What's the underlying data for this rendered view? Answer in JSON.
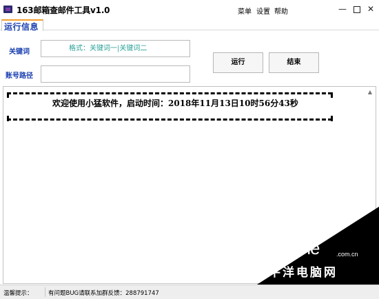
{
  "window": {
    "title": "163邮箱查邮件工具v1.0",
    "menu": [
      "菜单",
      "设置",
      "帮助"
    ],
    "controls": {
      "minimize": "—",
      "close": "✕"
    }
  },
  "tabs": [
    {
      "label": "运行信息",
      "active": true
    }
  ],
  "form": {
    "keyword_label": "关键词",
    "keyword_placeholder": "格式：关键词一|关键词二",
    "path_label": "账号路径",
    "path_value": ""
  },
  "buttons": {
    "run": "运行",
    "stop": "结束"
  },
  "log": {
    "line": "欢迎使用小猛软件，启动时间：2018年11月13日10时56分43秒"
  },
  "watermark": {
    "brand": "PConline",
    "domain": ".com.cn",
    "subtitle": "太平洋电脑网"
  },
  "status": {
    "label": "温馨提示：",
    "message": "有问题BUG请联系加群反馈：288791747"
  },
  "colors": {
    "label_blue": "#1a3fb0",
    "placeholder_teal": "#2aa198",
    "tab_accent": "#f39c2b"
  }
}
